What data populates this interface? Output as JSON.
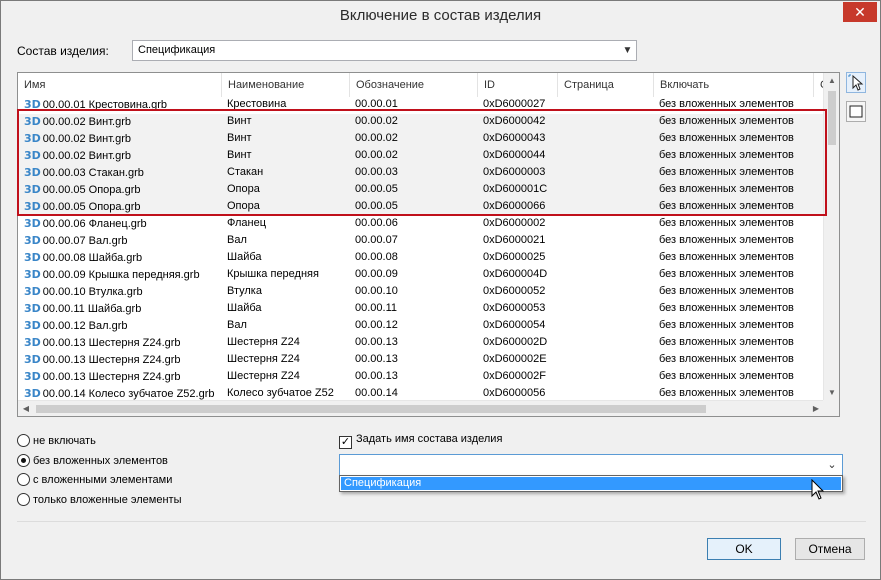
{
  "window": {
    "title": "Включение в состав изделия",
    "close_glyph": "✕"
  },
  "assembly": {
    "label": "Состав изделия:",
    "selected": "Спецификация"
  },
  "grid": {
    "columns": [
      "Имя",
      "Наименование",
      "Обозначение",
      "ID",
      "Страница",
      "Включать",
      "С"
    ],
    "rows": [
      {
        "name": "00.00.01 Крестовина.grb",
        "naim": "Крестовина",
        "obozn": "00.00.01",
        "id": "0xD6000027",
        "page": "",
        "incl": "без вложенных элементов"
      },
      {
        "name": "00.00.02 Винт.grb",
        "naim": "Винт",
        "obozn": "00.00.02",
        "id": "0xD6000042",
        "page": "",
        "incl": "без вложенных элементов"
      },
      {
        "name": "00.00.02 Винт.grb",
        "naim": "Винт",
        "obozn": "00.00.02",
        "id": "0xD6000043",
        "page": "",
        "incl": "без вложенных элементов"
      },
      {
        "name": "00.00.02 Винт.grb",
        "naim": "Винт",
        "obozn": "00.00.02",
        "id": "0xD6000044",
        "page": "",
        "incl": "без вложенных элементов"
      },
      {
        "name": "00.00.03 Стакан.grb",
        "naim": "Стакан",
        "obozn": "00.00.03",
        "id": "0xD6000003",
        "page": "",
        "incl": "без вложенных элементов"
      },
      {
        "name": "00.00.05 Опора.grb",
        "naim": "Опора",
        "obozn": "00.00.05",
        "id": "0xD600001C",
        "page": "",
        "incl": "без вложенных элементов"
      },
      {
        "name": "00.00.05 Опора.grb",
        "naim": "Опора",
        "obozn": "00.00.05",
        "id": "0xD6000066",
        "page": "",
        "incl": "без вложенных элементов"
      },
      {
        "name": "00.00.06 Фланец.grb",
        "naim": "Фланец",
        "obozn": "00.00.06",
        "id": "0xD6000002",
        "page": "",
        "incl": "без вложенных элементов"
      },
      {
        "name": "00.00.07 Вал.grb",
        "naim": "Вал",
        "obozn": "00.00.07",
        "id": "0xD6000021",
        "page": "",
        "incl": "без вложенных элементов"
      },
      {
        "name": "00.00.08 Шайба.grb",
        "naim": "Шайба",
        "obozn": "00.00.08",
        "id": "0xD6000025",
        "page": "",
        "incl": "без вложенных элементов"
      },
      {
        "name": "00.00.09 Крышка передняя.grb",
        "naim": "Крышка передняя",
        "obozn": "00.00.09",
        "id": "0xD600004D",
        "page": "",
        "incl": "без вложенных элементов"
      },
      {
        "name": "00.00.10 Втулка.grb",
        "naim": "Втулка",
        "obozn": "00.00.10",
        "id": "0xD6000052",
        "page": "",
        "incl": "без вложенных элементов"
      },
      {
        "name": "00.00.11 Шайба.grb",
        "naim": "Шайба",
        "obozn": "00.00.11",
        "id": "0xD6000053",
        "page": "",
        "incl": "без вложенных элементов"
      },
      {
        "name": "00.00.12 Вал.grb",
        "naim": "Вал",
        "obozn": "00.00.12",
        "id": "0xD6000054",
        "page": "",
        "incl": "без вложенных элементов"
      },
      {
        "name": "00.00.13 Шестерня Z24.grb",
        "naim": "Шестерня Z24",
        "obozn": "00.00.13",
        "id": "0xD600002D",
        "page": "",
        "incl": "без вложенных элементов"
      },
      {
        "name": "00.00.13 Шестерня Z24.grb",
        "naim": "Шестерня Z24",
        "obozn": "00.00.13",
        "id": "0xD600002E",
        "page": "",
        "incl": "без вложенных элементов"
      },
      {
        "name": "00.00.13 Шестерня Z24.grb",
        "naim": "Шестерня Z24",
        "obozn": "00.00.13",
        "id": "0xD600002F",
        "page": "",
        "incl": "без вложенных элементов"
      },
      {
        "name": "00.00.14 Колесо зубчатое Z52.grb",
        "naim": "Колесо зубчатое Z52",
        "obozn": "00.00.14",
        "id": "0xD6000056",
        "page": "",
        "incl": "без вложенных элементов"
      }
    ],
    "icon_text": "3D",
    "icon_name": "model-3d-icon"
  },
  "include_options": {
    "items": [
      {
        "label": "не включать",
        "checked": false
      },
      {
        "label": "без вложенных элементов",
        "checked": true
      },
      {
        "label": "с вложенными элементами",
        "checked": false
      },
      {
        "label": "только вложенные элементы",
        "checked": false
      }
    ]
  },
  "set_name": {
    "label": "Задать имя состава изделия",
    "checked": true,
    "check_glyph": "✓",
    "value": "",
    "dropdown_option": "Спецификация"
  },
  "buttons": {
    "ok": "OK",
    "cancel": "Отмена"
  },
  "colors": {
    "accent": "#3399ff",
    "highlight_frame": "#c0101b",
    "icon_3d": "#3a86c8"
  }
}
